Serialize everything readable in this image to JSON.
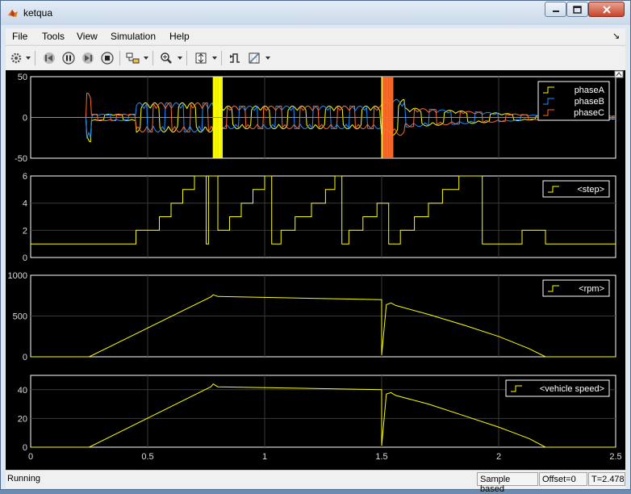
{
  "window": {
    "title": "ketqua"
  },
  "menu": [
    "File",
    "Tools",
    "View",
    "Simulation",
    "Help"
  ],
  "toolbar_icons": [
    "gear-icon",
    "step-back-icon",
    "pause-icon",
    "step-forward-icon",
    "stop-icon",
    "highlight-block-icon",
    "zoom-icon",
    "autoscale-icon",
    "trigger-icon",
    "cursor-measure-icon"
  ],
  "status": {
    "state": "Running",
    "mode": "Sample based",
    "offset": "Offset=0",
    "time": "T=2.478"
  },
  "colors": {
    "yellow": "#ffff00",
    "blue": "#1e90ff",
    "orange": "#ff6a28",
    "grid": "#3a3a3a",
    "axis": "#ffffff"
  },
  "chart_data": [
    {
      "type": "line",
      "ylim": [
        -50,
        50
      ],
      "xlim": [
        0,
        2.5
      ],
      "yticks": [
        "50",
        "0",
        "-50"
      ],
      "series": [
        {
          "name": "phaseA"
        },
        {
          "name": "phaseB"
        },
        {
          "name": "phaseC"
        }
      ]
    },
    {
      "type": "line",
      "ylim": [
        0,
        6
      ],
      "xlim": [
        0,
        2.5
      ],
      "yticks": [
        "6",
        "4",
        "2",
        "0"
      ],
      "series": [
        {
          "name": "<step>",
          "x": [
            0,
            0.45,
            0.45,
            0.55,
            0.55,
            0.6,
            0.6,
            0.65,
            0.65,
            0.7,
            0.7,
            0.75,
            0.75,
            0.76,
            0.76,
            0.8,
            0.8,
            0.85,
            0.85,
            0.9,
            0.9,
            0.95,
            0.95,
            1.0,
            1.0,
            1.03,
            1.03,
            1.07,
            1.07,
            1.13,
            1.13,
            1.2,
            1.2,
            1.26,
            1.26,
            1.3,
            1.3,
            1.33,
            1.33,
            1.36,
            1.36,
            1.42,
            1.42,
            1.48,
            1.48,
            1.53,
            1.53,
            1.58,
            1.58,
            1.64,
            1.64,
            1.7,
            1.7,
            1.76,
            1.76,
            1.83,
            1.83,
            1.93,
            1.93,
            2.1,
            2.1,
            2.2,
            2.2,
            2.5
          ],
          "y": [
            1,
            1,
            2,
            2,
            3,
            3,
            4,
            4,
            5,
            5,
            6,
            6,
            1,
            1,
            6,
            6,
            2,
            2,
            3,
            3,
            4,
            4,
            5,
            5,
            6,
            6,
            1,
            1,
            2,
            2,
            3,
            3,
            4,
            4,
            5,
            5,
            6,
            6,
            1,
            1,
            2,
            2,
            3,
            3,
            4,
            4,
            1,
            1,
            2,
            2,
            3,
            3,
            4,
            4,
            5,
            5,
            6,
            6,
            1,
            1,
            2,
            2,
            1,
            1
          ]
        }
      ]
    },
    {
      "type": "line",
      "ylim": [
        0,
        1000
      ],
      "xlim": [
        0,
        2.5
      ],
      "yticks": [
        "1000",
        "500",
        "0"
      ],
      "series": [
        {
          "name": "<rpm>",
          "x": [
            0,
            0.25,
            0.77,
            0.78,
            0.8,
            1.5,
            1.5,
            1.52,
            1.54,
            1.56,
            1.7,
            1.85,
            2.0,
            2.13,
            2.2,
            2.5
          ],
          "y": [
            0,
            0,
            735,
            760,
            740,
            700,
            20,
            640,
            660,
            630,
            520,
            390,
            250,
            100,
            0,
            0
          ]
        }
      ]
    },
    {
      "type": "line",
      "ylim": [
        0,
        50
      ],
      "xlim": [
        0,
        2.5
      ],
      "yticks": [
        "40",
        "20",
        "0"
      ],
      "xticks": [
        "0",
        "0.5",
        "1",
        "1.5",
        "2",
        "2.5"
      ],
      "series": [
        {
          "name": "<vehicle speed>",
          "x": [
            0,
            0.25,
            0.77,
            0.78,
            0.8,
            1.5,
            1.5,
            1.52,
            1.54,
            1.56,
            1.7,
            1.85,
            2.0,
            2.13,
            2.2,
            2.5
          ],
          "y": [
            0,
            0,
            42,
            44,
            42,
            40,
            1,
            37,
            38,
            36,
            30,
            22,
            14,
            6,
            0,
            0
          ]
        }
      ]
    }
  ]
}
